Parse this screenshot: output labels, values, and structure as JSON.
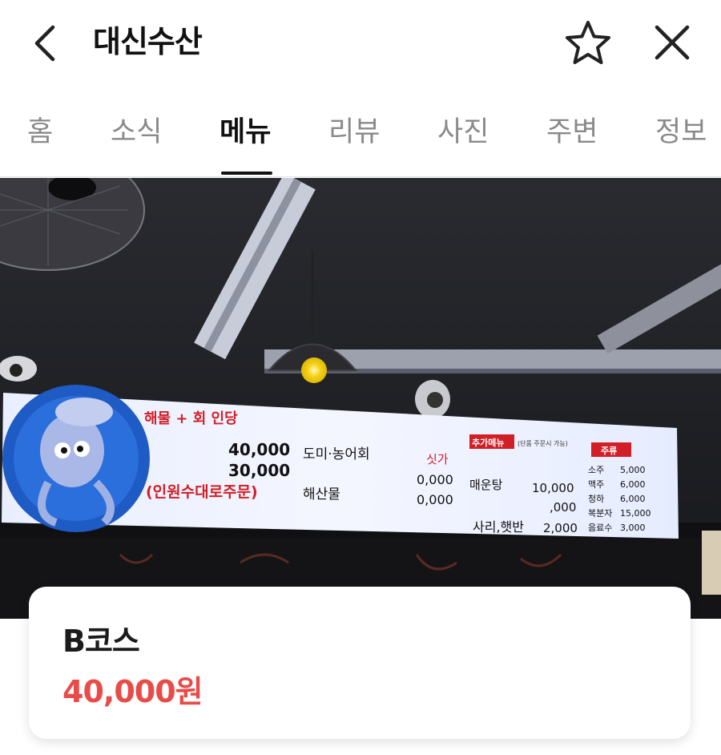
{
  "header": {
    "title": "대신수산",
    "icons": {
      "back": "chevron-left-icon",
      "favorite": "star-outline-icon",
      "close": "close-icon"
    }
  },
  "tabs": [
    {
      "label": "홈",
      "active": false
    },
    {
      "label": "소식",
      "active": false
    },
    {
      "label": "메뉴",
      "active": true
    },
    {
      "label": "리뷰",
      "active": false
    },
    {
      "label": "사진",
      "active": false
    },
    {
      "label": "주변",
      "active": false
    },
    {
      "label": "정보",
      "active": false
    }
  ],
  "photo": {
    "menu_board": {
      "headline": "해물 + 회 인당",
      "prices": [
        "40,000",
        "30,000"
      ],
      "note": "(인원수대로주문)",
      "col2_items": [
        "도미·농어회",
        "해산물"
      ],
      "col2_header": "싯가",
      "col2_prices": [
        "0,000",
        "0,000"
      ],
      "extra_menu_title": "추가메뉴",
      "extra_menu_note": "(단품 주문시 가능)",
      "extra_items": [
        {
          "name": "매운탕",
          "price": "10,000"
        },
        {
          "name": "",
          "price": ",000"
        },
        {
          "name": "사리,햇반",
          "price": "2,000"
        }
      ],
      "drinks_title": "주류",
      "drinks": [
        {
          "name": "소주",
          "price": "5,000"
        },
        {
          "name": "맥주",
          "price": "6,000"
        },
        {
          "name": "청하",
          "price": "6,000"
        },
        {
          "name": "복분자",
          "price": "15,000"
        },
        {
          "name": "음료수",
          "price": "3,000"
        }
      ]
    }
  },
  "item": {
    "name": "B코스",
    "price": "40,000원"
  },
  "colors": {
    "price_red": "#e84c49",
    "active_tab": "#111111",
    "inactive_tab": "#8a8a8a"
  }
}
